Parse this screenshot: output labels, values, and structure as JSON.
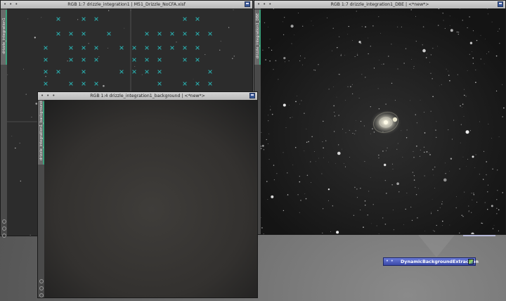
{
  "windows": {
    "nocfa": {
      "title": "RGB 1:7 drizzle_integration1 | M51_Drizzle_NoCFA.xisf",
      "sidetab_label": "drizzle_integration1",
      "markers": "green-x-sample-markers"
    },
    "dbe": {
      "title": "RGB 1:7 drizzle_integration1_DBE | <*new*>",
      "sidetab_label": "drizzle_integration1_DBE"
    },
    "background": {
      "title": "RGB 1:4 drizzle_integration1_background | <*new*>",
      "sidetab_label": "drizzle_integration1_background"
    }
  },
  "process_icon": {
    "label": "DynamicBackgroundExtraction",
    "icon": "dbe-process-icon"
  },
  "icons": {
    "window_menu": "window-menu-icon",
    "window_controls": "window-dots-icon"
  },
  "colors": {
    "marker": "#2aa8a8",
    "titlebar": "#c8c8c8",
    "process_bar": "#4b5bbf"
  }
}
